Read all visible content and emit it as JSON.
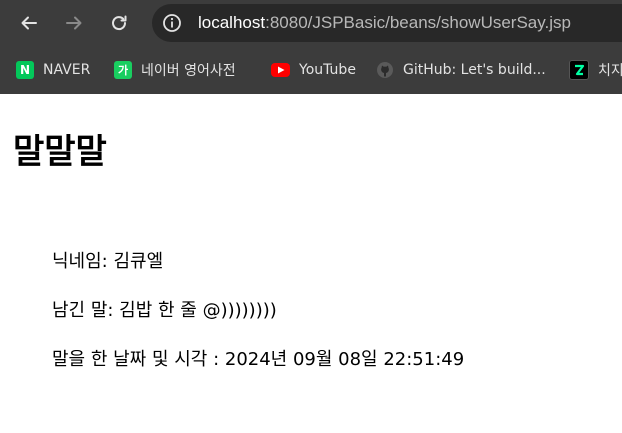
{
  "browser": {
    "url_host": "localhost",
    "url_path": ":8080/JSPBasic/beans/showUserSay.jsp",
    "back_icon": "arrow-left-icon",
    "forward_icon": "arrow-right-icon",
    "reload_icon": "reload-icon",
    "site_info_icon": "info-icon"
  },
  "bookmarks": [
    {
      "label": "NAVER",
      "icon": "naver-icon",
      "icon_text": "N",
      "color": "#03c75a"
    },
    {
      "label": "네이버 영어사전",
      "icon": "naver-dictionary-icon",
      "icon_text": "가",
      "color": "#19ce60"
    },
    {
      "label": "YouTube",
      "icon": "youtube-icon",
      "icon_text": "",
      "color": "#ff0000"
    },
    {
      "label": "GitHub: Let's build...",
      "icon": "github-icon",
      "icon_text": "",
      "color": "#3c3c3c"
    },
    {
      "label": "치지",
      "icon": "chzzk-icon",
      "icon_text": "",
      "color": "#000000"
    }
  ],
  "page": {
    "title": "말말말",
    "nickname_line": "닉네임: 김큐엘",
    "message_line": "남긴 말: 김밥 한 줄 @))))))))",
    "datetime_line": "말을 한 날짜 및 시각 : 2024년 09월 08일 22:51:49"
  }
}
